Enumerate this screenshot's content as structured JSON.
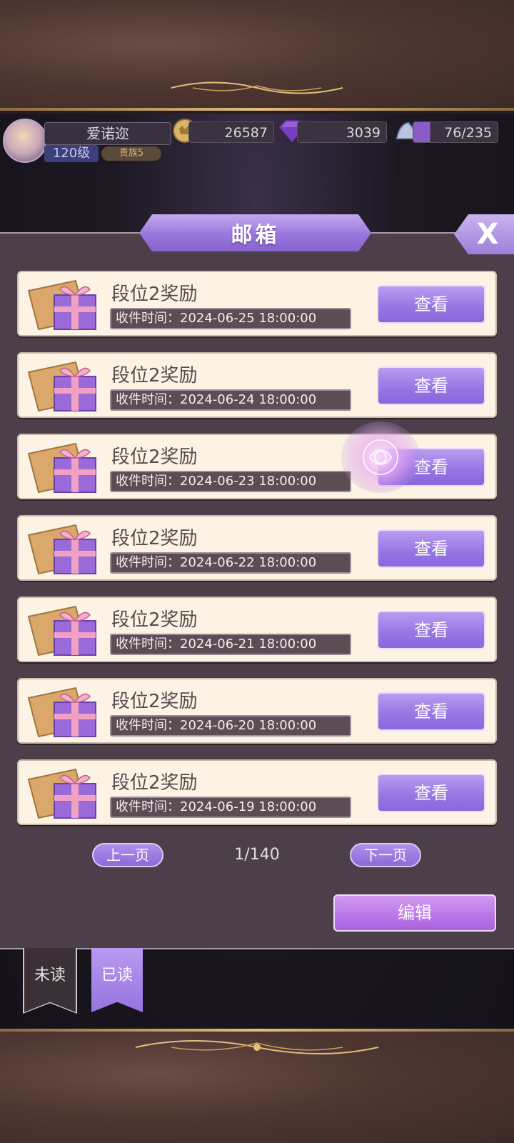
{
  "hud": {
    "player_name": "爱诺迩",
    "level": "120级",
    "rank": "贵族5",
    "gold": "26587",
    "diamonds": "3039",
    "stamina": "76/235"
  },
  "mailbox": {
    "title": "邮箱",
    "close_label": "X",
    "mails": [
      {
        "title": "段位2奖励",
        "time": "收件时间：2024-06-25 18:00:00",
        "button": "查看"
      },
      {
        "title": "段位2奖励",
        "time": "收件时间：2024-06-24 18:00:00",
        "button": "查看"
      },
      {
        "title": "段位2奖励",
        "time": "收件时间：2024-06-23 18:00:00",
        "button": "查看"
      },
      {
        "title": "段位2奖励",
        "time": "收件时间：2024-06-22 18:00:00",
        "button": "查看"
      },
      {
        "title": "段位2奖励",
        "time": "收件时间：2024-06-21 18:00:00",
        "button": "查看"
      },
      {
        "title": "段位2奖励",
        "time": "收件时间：2024-06-20 18:00:00",
        "button": "查看"
      },
      {
        "title": "段位2奖励",
        "time": "收件时间：2024-06-19 18:00:00",
        "button": "查看"
      }
    ],
    "pagination": {
      "prev_label": "上一页",
      "page_indicator": "1/140",
      "next_label": "下一页"
    },
    "edit_label": "编辑",
    "tabs": [
      {
        "label": "未读"
      },
      {
        "label": "已读"
      }
    ]
  },
  "colors": {
    "accent_purple": "#9675e3",
    "panel_bg": "#4b4049",
    "card_bg": "#fbf3e4",
    "gold_trim": "#e3bf7a"
  },
  "icons": [
    "gold-coin-icon",
    "diamond-icon",
    "glass-slipper-icon",
    "mail-gift-icon",
    "rose-icon"
  ]
}
